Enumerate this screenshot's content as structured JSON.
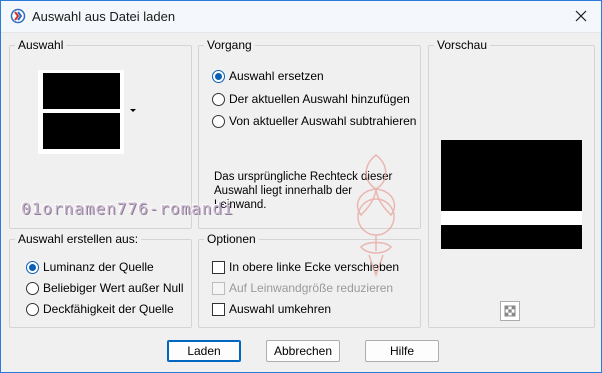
{
  "window": {
    "title": "Auswahl aus Datei laden",
    "close_icon": "close-icon"
  },
  "colors": {
    "accent": "#0a5fb4",
    "window_border": "#2b7bd8",
    "watermark": "#c9b7d0",
    "seal": "#e8a9a2"
  },
  "selection_group": {
    "title": "Auswahl"
  },
  "operation_group": {
    "title": "Vorgang",
    "options": [
      {
        "label": "Auswahl ersetzen",
        "checked": true
      },
      {
        "label": "Der aktuellen Auswahl hinzufügen",
        "checked": false
      },
      {
        "label": "Von aktueller Auswahl subtrahieren",
        "checked": false
      }
    ],
    "info": "Das ursprüngliche Rechteck dieser\nAuswahl liegt innerhalb der\nLeinwand."
  },
  "create_from_group": {
    "title": "Auswahl erstellen aus:",
    "options": [
      {
        "label": "Luminanz der Quelle",
        "checked": true
      },
      {
        "label": "Beliebiger Wert außer Null",
        "checked": false
      },
      {
        "label": "Deckfähigkeit der Quelle",
        "checked": false
      }
    ]
  },
  "options_group": {
    "title": "Optionen",
    "checks": [
      {
        "label": "In obere linke Ecke verschieben",
        "checked": false,
        "disabled": false
      },
      {
        "label": "Auf Leinwandgröße reduzieren",
        "checked": false,
        "disabled": true
      },
      {
        "label": "Auswahl umkehren",
        "checked": false,
        "disabled": false
      }
    ]
  },
  "preview_group": {
    "title": "Vorschau",
    "transparency_icon": "checkerboard-icon"
  },
  "buttons": {
    "load": "Laden",
    "cancel": "Abbrechen",
    "help": "Hilfe"
  },
  "watermark": {
    "text": "01ornamen776-romandi"
  }
}
